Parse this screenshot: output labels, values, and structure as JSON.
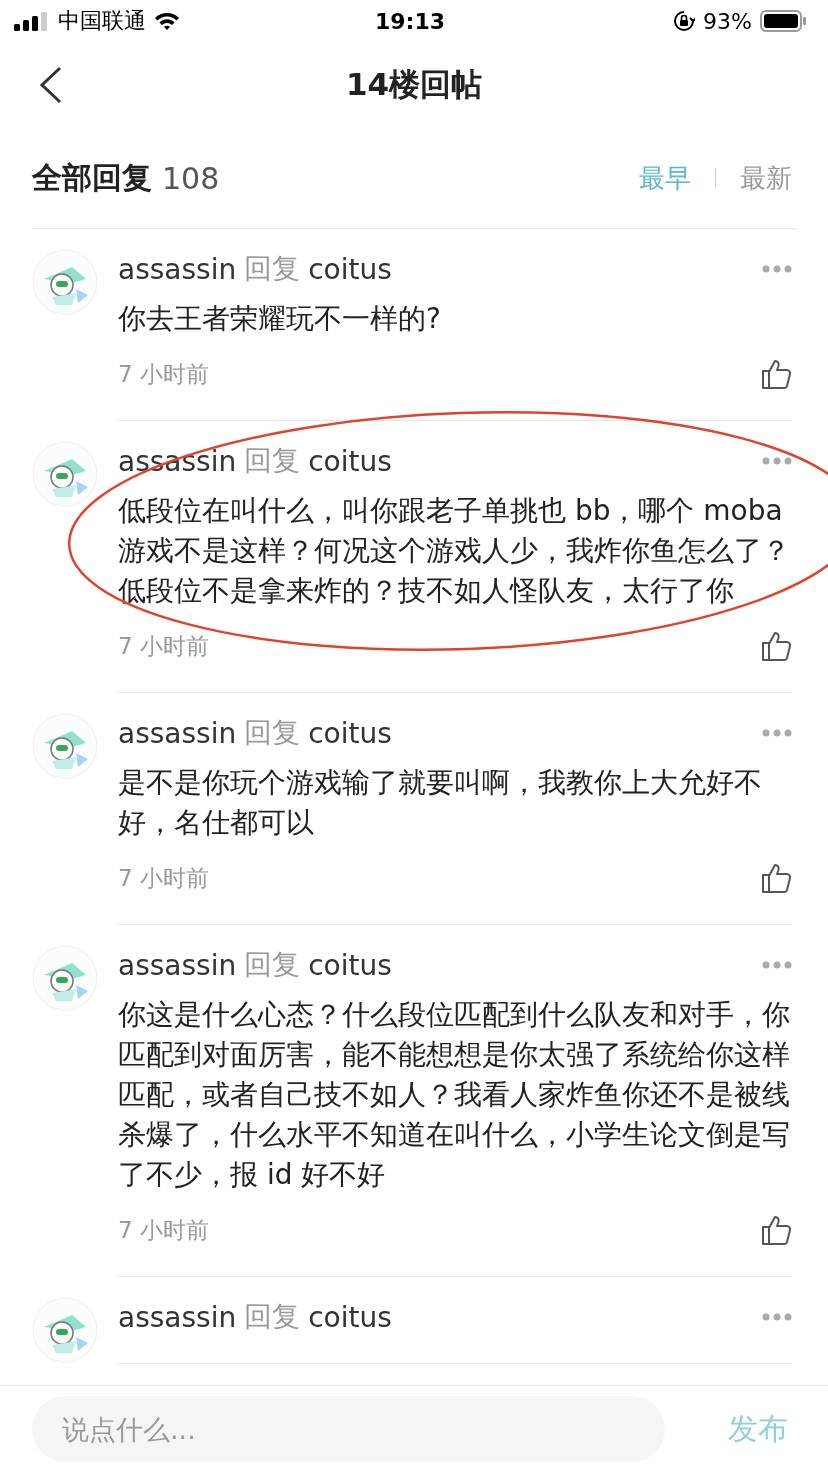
{
  "status_bar": {
    "carrier": "中国联通",
    "time": "19:13",
    "battery": "93%"
  },
  "header": {
    "title": "14楼回帖"
  },
  "replies_header": {
    "label": "全部回复",
    "count": "108",
    "sort_options": [
      {
        "label": "最早",
        "selected": true
      },
      {
        "label": "最新",
        "selected": false
      }
    ]
  },
  "comments": [
    {
      "author": "assassin",
      "reply_word": "回复",
      "target": "coitus",
      "text": "你去王者荣耀玩不一样的?",
      "time": "7 小时前",
      "highlighted": false
    },
    {
      "author": "assassin",
      "reply_word": "回复",
      "target": "coitus",
      "text": "低段位在叫什么，叫你跟老子单挑也 bb，哪个 moba游戏不是这样？何况这个游戏人少，我炸你鱼怎么了？低段位不是拿来炸的？技不如人怪队友，太行了你",
      "time": "7 小时前",
      "highlighted": true
    },
    {
      "author": "assassin",
      "reply_word": "回复",
      "target": "coitus",
      "text": "是不是你玩个游戏输了就要叫啊，我教你上大允好不好，名仕都可以",
      "time": "7 小时前",
      "highlighted": false
    },
    {
      "author": "assassin",
      "reply_word": "回复",
      "target": "coitus",
      "text": "你这是什么心态？什么段位匹配到什么队友和对手，你匹配到对面厉害，能不能想想是你太强了系统给你这样匹配，或者自己技不如人？我看人家炸鱼你还不是被线杀爆了，什么水平不知道在叫什么，小学生论文倒是写了不少，报 id 好不好",
      "time": "7 小时前",
      "highlighted": false
    },
    {
      "author": "assassin",
      "reply_word": "回复",
      "target": "coitus",
      "highlighted": false
    }
  ],
  "reply_bar": {
    "placeholder": "说点什么...",
    "send": "发布"
  }
}
